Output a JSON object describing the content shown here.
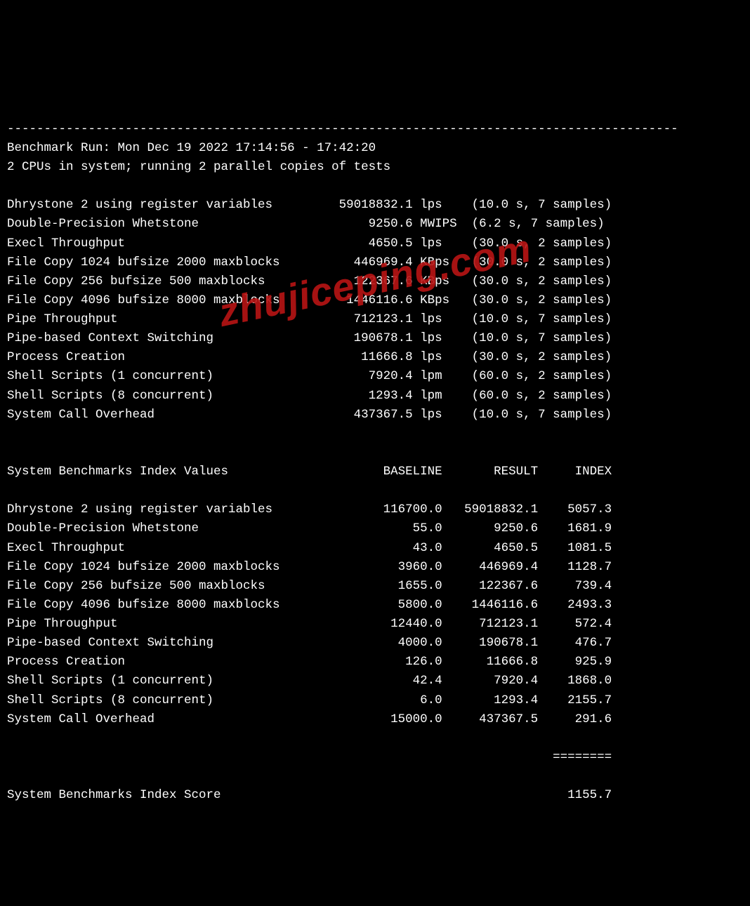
{
  "watermark": "zhujiceping.com",
  "separator": "-------------------------------------------------------------------------------------------",
  "header": {
    "run_line": "Benchmark Run: Mon Dec 19 2022 17:14:56 - 17:42:20",
    "cpu_line": "2 CPUs in system; running 2 parallel copies of tests"
  },
  "tests": [
    {
      "name": "Dhrystone 2 using register variables",
      "value": "59018832.1",
      "unit": "lps",
      "timing": "(10.0 s, 7 samples)"
    },
    {
      "name": "Double-Precision Whetstone",
      "value": "9250.6",
      "unit": "MWIPS",
      "timing": "(6.2 s, 7 samples)"
    },
    {
      "name": "Execl Throughput",
      "value": "4650.5",
      "unit": "lps",
      "timing": "(30.0 s, 2 samples)"
    },
    {
      "name": "File Copy 1024 bufsize 2000 maxblocks",
      "value": "446969.4",
      "unit": "KBps",
      "timing": "(30.0 s, 2 samples)"
    },
    {
      "name": "File Copy 256 bufsize 500 maxblocks",
      "value": "122367.6",
      "unit": "KBps",
      "timing": "(30.0 s, 2 samples)"
    },
    {
      "name": "File Copy 4096 bufsize 8000 maxblocks",
      "value": "1446116.6",
      "unit": "KBps",
      "timing": "(30.0 s, 2 samples)"
    },
    {
      "name": "Pipe Throughput",
      "value": "712123.1",
      "unit": "lps",
      "timing": "(10.0 s, 7 samples)"
    },
    {
      "name": "Pipe-based Context Switching",
      "value": "190678.1",
      "unit": "lps",
      "timing": "(10.0 s, 7 samples)"
    },
    {
      "name": "Process Creation",
      "value": "11666.8",
      "unit": "lps",
      "timing": "(30.0 s, 2 samples)"
    },
    {
      "name": "Shell Scripts (1 concurrent)",
      "value": "7920.4",
      "unit": "lpm",
      "timing": "(60.0 s, 2 samples)"
    },
    {
      "name": "Shell Scripts (8 concurrent)",
      "value": "1293.4",
      "unit": "lpm",
      "timing": "(60.0 s, 2 samples)"
    },
    {
      "name": "System Call Overhead",
      "value": "437367.5",
      "unit": "lps",
      "timing": "(10.0 s, 7 samples)"
    }
  ],
  "index_header": {
    "title": "System Benchmarks Index Values",
    "baseline": "BASELINE",
    "result": "RESULT",
    "index": "INDEX"
  },
  "index_rows": [
    {
      "name": "Dhrystone 2 using register variables",
      "baseline": "116700.0",
      "result": "59018832.1",
      "index": "5057.3"
    },
    {
      "name": "Double-Precision Whetstone",
      "baseline": "55.0",
      "result": "9250.6",
      "index": "1681.9"
    },
    {
      "name": "Execl Throughput",
      "baseline": "43.0",
      "result": "4650.5",
      "index": "1081.5"
    },
    {
      "name": "File Copy 1024 bufsize 2000 maxblocks",
      "baseline": "3960.0",
      "result": "446969.4",
      "index": "1128.7"
    },
    {
      "name": "File Copy 256 bufsize 500 maxblocks",
      "baseline": "1655.0",
      "result": "122367.6",
      "index": "739.4"
    },
    {
      "name": "File Copy 4096 bufsize 8000 maxblocks",
      "baseline": "5800.0",
      "result": "1446116.6",
      "index": "2493.3"
    },
    {
      "name": "Pipe Throughput",
      "baseline": "12440.0",
      "result": "712123.1",
      "index": "572.4"
    },
    {
      "name": "Pipe-based Context Switching",
      "baseline": "4000.0",
      "result": "190678.1",
      "index": "476.7"
    },
    {
      "name": "Process Creation",
      "baseline": "126.0",
      "result": "11666.8",
      "index": "925.9"
    },
    {
      "name": "Shell Scripts (1 concurrent)",
      "baseline": "42.4",
      "result": "7920.4",
      "index": "1868.0"
    },
    {
      "name": "Shell Scripts (8 concurrent)",
      "baseline": "6.0",
      "result": "1293.4",
      "index": "2155.7"
    },
    {
      "name": "System Call Overhead",
      "baseline": "15000.0",
      "result": "437367.5",
      "index": "291.6"
    }
  ],
  "score_sep": "========",
  "score": {
    "label": "System Benchmarks Index Score",
    "value": "1155.7"
  }
}
